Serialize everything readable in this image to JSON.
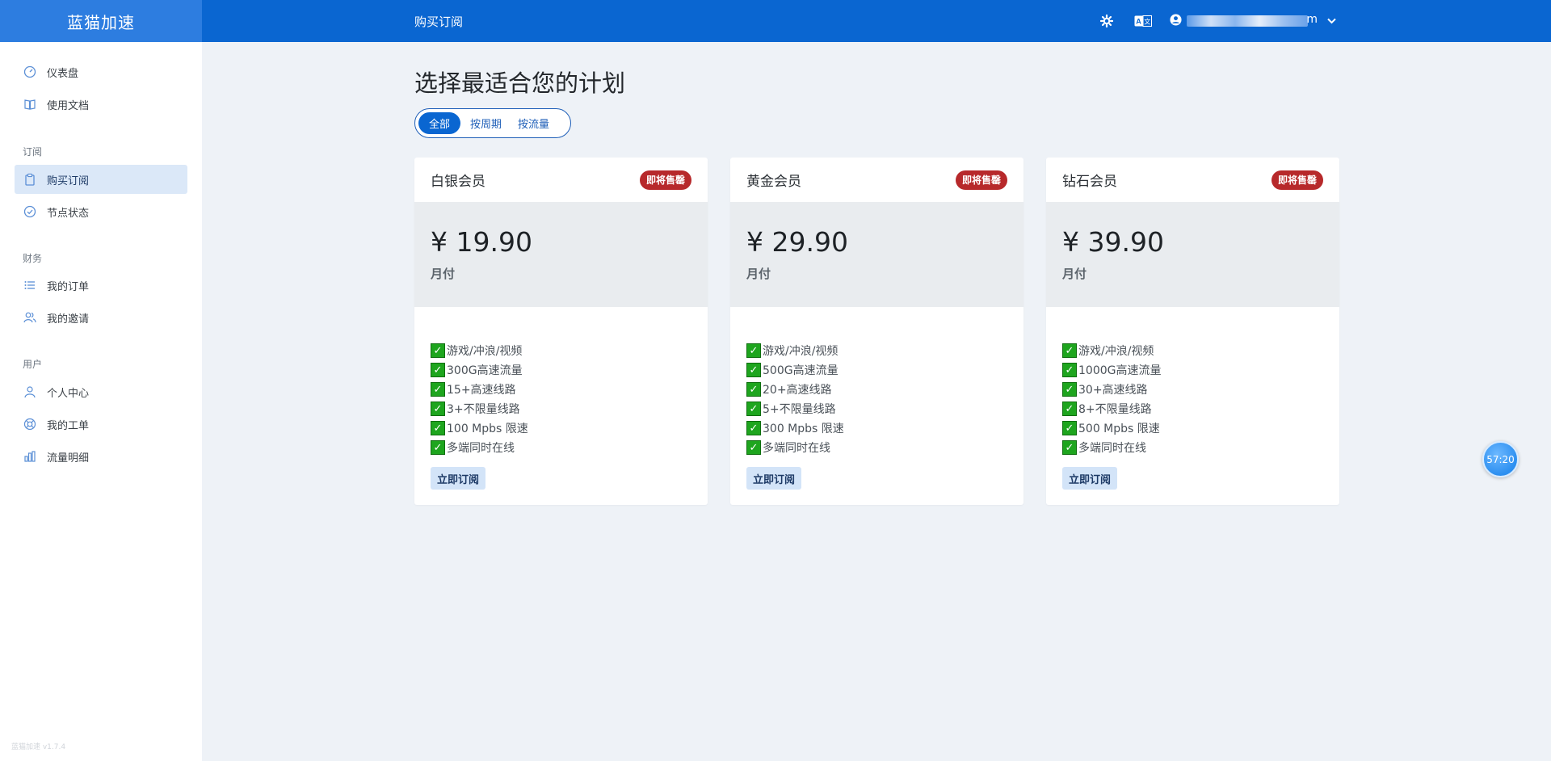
{
  "header": {
    "brand": "蓝猫加速",
    "title": "购买订阅",
    "user_suffix": "m",
    "icons": [
      "gear-icon",
      "language-icon",
      "user-icon",
      "chevron-down-icon"
    ]
  },
  "sidebar": {
    "items": [
      {
        "label": "仪表盘",
        "icon": "dashboard-icon"
      },
      {
        "label": "使用文档",
        "icon": "book-icon"
      },
      {
        "label": "购买订阅",
        "icon": "clipboard-icon",
        "active": true
      },
      {
        "label": "节点状态",
        "icon": "check-circle-icon"
      },
      {
        "label": "我的订单",
        "icon": "list-icon"
      },
      {
        "label": "我的邀请",
        "icon": "users-icon"
      },
      {
        "label": "个人中心",
        "icon": "user-icon"
      },
      {
        "label": "我的工单",
        "icon": "support-icon"
      },
      {
        "label": "流量明细",
        "icon": "bar-chart-icon"
      }
    ],
    "sections": [
      "订阅",
      "财务",
      "用户"
    ],
    "version": "蓝猫加速 v1.7.4"
  },
  "main": {
    "heading": "选择最适合您的计划",
    "filters": [
      "全部",
      "按周期",
      "按流量"
    ],
    "active_filter": "全部",
    "plans": [
      {
        "name": "白银会员",
        "badge": "即将售罄",
        "price": "¥ 19.90",
        "period": "月付",
        "features": [
          "游戏/冲浪/视频",
          "300G高速流量",
          "15+高速线路",
          "3+不限量线路",
          "100 Mpbs 限速",
          "多端同时在线"
        ],
        "button": "立即订阅"
      },
      {
        "name": "黄金会员",
        "badge": "即将售罄",
        "price": "¥ 29.90",
        "period": "月付",
        "features": [
          "游戏/冲浪/视频",
          "500G高速流量",
          "20+高速线路",
          "5+不限量线路",
          "300 Mpbs 限速",
          "多端同时在线"
        ],
        "button": "立即订阅"
      },
      {
        "name": "钻石会员",
        "badge": "即将售罄",
        "price": "¥ 39.90",
        "period": "月付",
        "features": [
          "游戏/冲浪/视频",
          "1000G高速流量",
          "30+高速线路",
          "8+不限量线路",
          "500 Mpbs 限速",
          "多端同时在线"
        ],
        "button": "立即订阅"
      }
    ]
  },
  "timer": "57:20",
  "colors": {
    "accent": "#0a66d1",
    "badge": "#b7292b",
    "check": "#1ea51e",
    "page_bg": "#eef2f7"
  }
}
